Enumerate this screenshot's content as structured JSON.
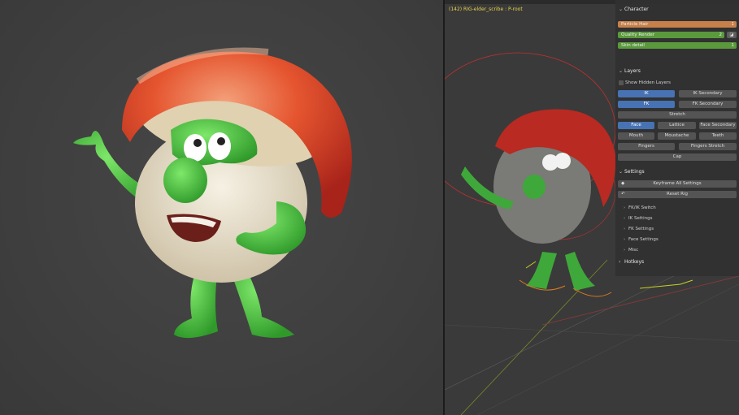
{
  "viewport": {
    "header_text": "(142) RIG-elder_scribe : P-root"
  },
  "panel": {
    "character": {
      "title": "Character",
      "props": [
        {
          "label": "Particle Hair",
          "value": "1",
          "color": "#c8804a"
        },
        {
          "label": "Quality Render",
          "value": "2",
          "color": "#5a9a3c"
        },
        {
          "label": "Skin detail",
          "value": "1",
          "color": "#5a9a3c"
        }
      ]
    },
    "layers": {
      "title": "Layers",
      "show_hidden_label": "Show Hidden Layers",
      "buttons": {
        "ik": "IK",
        "ik_secondary": "IK Secondary",
        "fk": "FK",
        "fk_secondary": "FK Secondary",
        "stretch": "Stretch",
        "face": "Face",
        "lattice": "Lattice",
        "face_secondary": "Face Secondary",
        "mouth": "Mouth",
        "moustache": "Moustache",
        "teeth": "Teeth",
        "fingers": "Fingers",
        "fingers_stretch": "Fingers Stretch",
        "cap": "Cap"
      }
    },
    "settings": {
      "title": "Settings",
      "keyframe_all": "Keyframe All Settings",
      "reset_rig": "Reset Rig",
      "subpanels": [
        "FK/IK Switch",
        "IK Settings",
        "FK Settings",
        "Face Settings",
        "Misc"
      ]
    },
    "hotkeys": {
      "title": "Hotkeys"
    }
  },
  "colors": {
    "accent": "#4772b3",
    "header_text": "#e6d54a"
  }
}
